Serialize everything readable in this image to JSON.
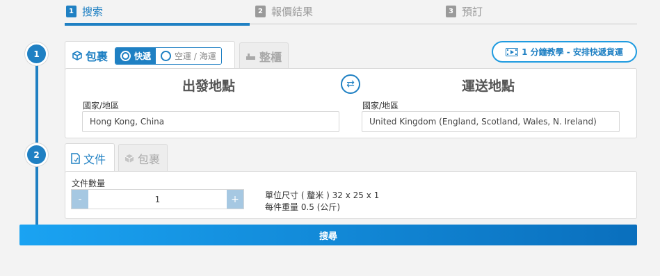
{
  "steps": [
    {
      "num": "1",
      "label": "搜索"
    },
    {
      "num": "2",
      "label": "報價結果"
    },
    {
      "num": "3",
      "label": "預訂"
    }
  ],
  "timeline": {
    "step1": "1",
    "step2": "2"
  },
  "shipment_tabs": {
    "parcel_label": "包裹",
    "express_label": "快遞",
    "freight_label": "空運 / 海運",
    "container_label": "整櫃"
  },
  "tutorial": {
    "label": "1 分鐘教學 - 安排快遞貨運"
  },
  "origin": {
    "title": "出發地點",
    "field_label": "國家/地區",
    "value": "Hong Kong, China"
  },
  "destination": {
    "title": "運送地點",
    "field_label": "國家/地區",
    "value": "United Kingdom (England, Scotland, Wales, N. Ireland)"
  },
  "package_tabs": {
    "document_label": "文件",
    "parcel_label": "包裹"
  },
  "document": {
    "qty_label": "文件數量",
    "qty_value": "1",
    "minus": "-",
    "plus": "+",
    "size_text": "單位尺寸 ( 釐米 )  32 x 25 x 1",
    "weight_text": "每件重量 0.5 (公斤)"
  },
  "search": {
    "label": "搜尋"
  },
  "colors": {
    "accent": "#1f80c3",
    "inactive": "#9a9a9a"
  }
}
